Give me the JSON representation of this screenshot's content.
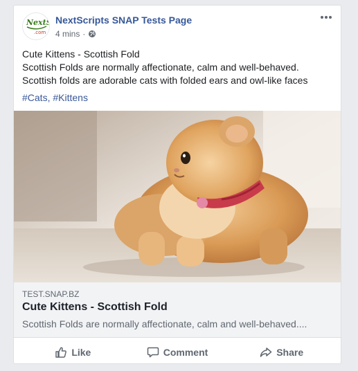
{
  "post": {
    "page_name": "NextScripts SNAP Tests Page",
    "time": "4 mins",
    "separator": "·",
    "privacy_icon": "globe-icon",
    "more_icon": "more-icon",
    "avatar": {
      "logo_text": "NextScripts",
      "logo_sub": ".com"
    },
    "text_lines": [
      "Cute Kittens - Scottish Fold",
      "Scottish Folds are normally affectionate, calm and well-behaved.",
      "Scottish folds are adorable cats with folded ears and owl-like faces"
    ],
    "hashtags": [
      "#Cats",
      "#Kittens"
    ],
    "hashtag_separator": ", ",
    "link_preview": {
      "domain": "TEST.SNAP.BZ",
      "title": "Cute Kittens - Scottish Fold",
      "description": "Scottish Folds are normally affectionate, calm and well-behaved...."
    },
    "actions": [
      {
        "label": "Like",
        "icon": "thumbs-up-icon"
      },
      {
        "label": "Comment",
        "icon": "comment-icon"
      },
      {
        "label": "Share",
        "icon": "share-icon"
      }
    ]
  },
  "colors": {
    "page_background": "#e9ebee",
    "link_blue": "#365899",
    "secondary_text": "#606770"
  }
}
